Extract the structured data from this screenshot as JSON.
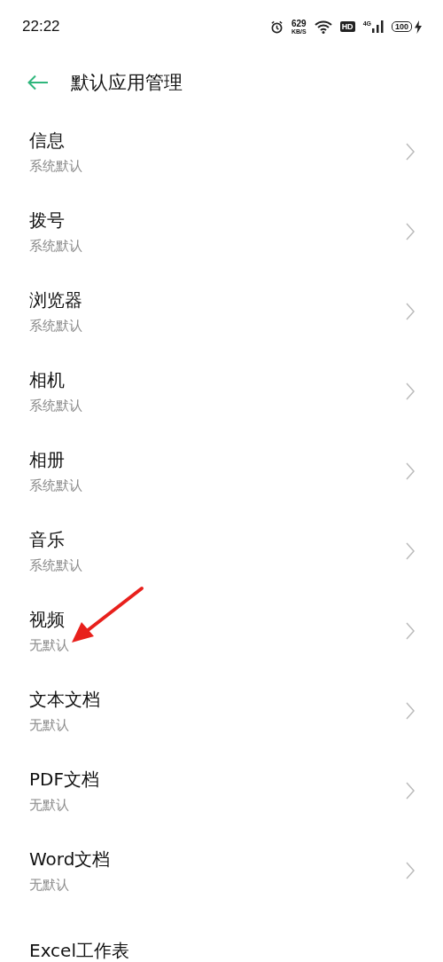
{
  "status_bar": {
    "time": "22:22",
    "speed_value": "629",
    "speed_unit": "KB/S",
    "hd_label": "HD",
    "network_label": "4G",
    "battery": "100"
  },
  "header": {
    "title": "默认应用管理"
  },
  "items": [
    {
      "title": "信息",
      "subtitle": "系统默认"
    },
    {
      "title": "拨号",
      "subtitle": "系统默认"
    },
    {
      "title": "浏览器",
      "subtitle": "系统默认"
    },
    {
      "title": "相机",
      "subtitle": "系统默认"
    },
    {
      "title": "相册",
      "subtitle": "系统默认"
    },
    {
      "title": "音乐",
      "subtitle": "系统默认"
    },
    {
      "title": "视频",
      "subtitle": "无默认"
    },
    {
      "title": "文本文档",
      "subtitle": "无默认"
    },
    {
      "title": "PDF文档",
      "subtitle": "无默认"
    },
    {
      "title": "Word文档",
      "subtitle": "无默认"
    },
    {
      "title": "Excel工作表"
    }
  ]
}
